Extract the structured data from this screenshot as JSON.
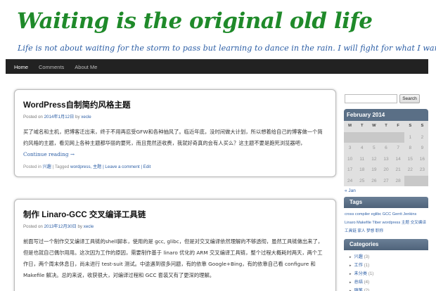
{
  "site": {
    "title": "Waiting is the original old life",
    "tagline": "Life is not about waiting for the storm to pass but learning to dance in the rain. I will fight for what I want."
  },
  "nav": [
    "Home",
    "Comments",
    "About Me"
  ],
  "posts": [
    {
      "title": "WordPress自制简约风格主题",
      "meta_prefix": "Posted on",
      "date": "2014年1月12日",
      "meta_by": "by",
      "author": "xecle",
      "body": "买了域名和主机，把博客迁出来，终于不用再忍受GFW和各种抽风了。临近年底，没时间做大计划，所以想着给自己的博客做一个简约风格的主题，看见网上各种主题都华丽的要死，而且竟然还收费，我就好奇真的会有人买么？这主题不要是跑死浏览器吧，",
      "more": "Continue reading →",
      "footer_posted_in": "Posted in",
      "category": "兴趣",
      "footer_tagged": "| Tagged",
      "tags": "wordpress, 主题",
      "footer_comment": "| Leave a comment",
      "footer_edit": "| Edit"
    },
    {
      "title": "制作 Linaro-GCC 交叉编译工具链",
      "meta_prefix": "Posted on",
      "date": "2013年12月30日",
      "meta_by": "by",
      "author": "xecle",
      "body": "前面写过一个制作交叉编译工具链的shell脚本，使用的是 gcc, glibc，但是对交叉编译依然理解的不够透彻，虽然工具链做出来了，但是也就自己偶尔用用。这次因为工作的原因，需要制作基于 linaro 优化的 ARM 交叉编译工具链，整个过程大概耗时两天，两个工作日，两个周末休息日，尚未进行 test-suit 测试。中途遇到很多问题，有的依靠 Google+Bing，有的依靠自己看 configure 和 Makefile 解决。总的来说，收获很大，对编译过程和 GCC 套装又有了更深的理解。"
    }
  ],
  "sidebar": {
    "search_button": "Search",
    "calendar": {
      "month": "February 2014",
      "dow": [
        "M",
        "T",
        "W",
        "T",
        "F",
        "S",
        "S"
      ],
      "days": [
        "",
        "",
        "",
        "",
        "",
        "1",
        "2",
        "3",
        "4",
        "5",
        "6",
        "7",
        "8",
        "9",
        "10",
        "11",
        "12",
        "13",
        "14",
        "15",
        "16",
        "17",
        "18",
        "19",
        "20",
        "21",
        "22",
        "23",
        "24",
        "25",
        "26",
        "27",
        "28",
        "",
        ""
      ],
      "prev": "« Jan"
    },
    "tags_title": "Tags",
    "tags_text": "cross compiler eglibc GCC Gerrit Jenkins Linaro Makefile Tiber wordpress 主题 交叉编译工具链 家人 梦想 职称",
    "categories_title": "Categories",
    "categories": [
      {
        "name": "兴趣",
        "count": "(3)"
      },
      {
        "name": "工作",
        "count": "(1)"
      },
      {
        "name": "未分类",
        "count": "(1)"
      },
      {
        "name": "总结",
        "count": "(4)"
      },
      {
        "name": "随笔",
        "count": "(2)"
      }
    ]
  },
  "colors": {
    "title_green": "#1f8a2a",
    "link_blue": "#2d5fa6",
    "nav_bg": "#222222",
    "widget_head": "#5a6f86"
  }
}
